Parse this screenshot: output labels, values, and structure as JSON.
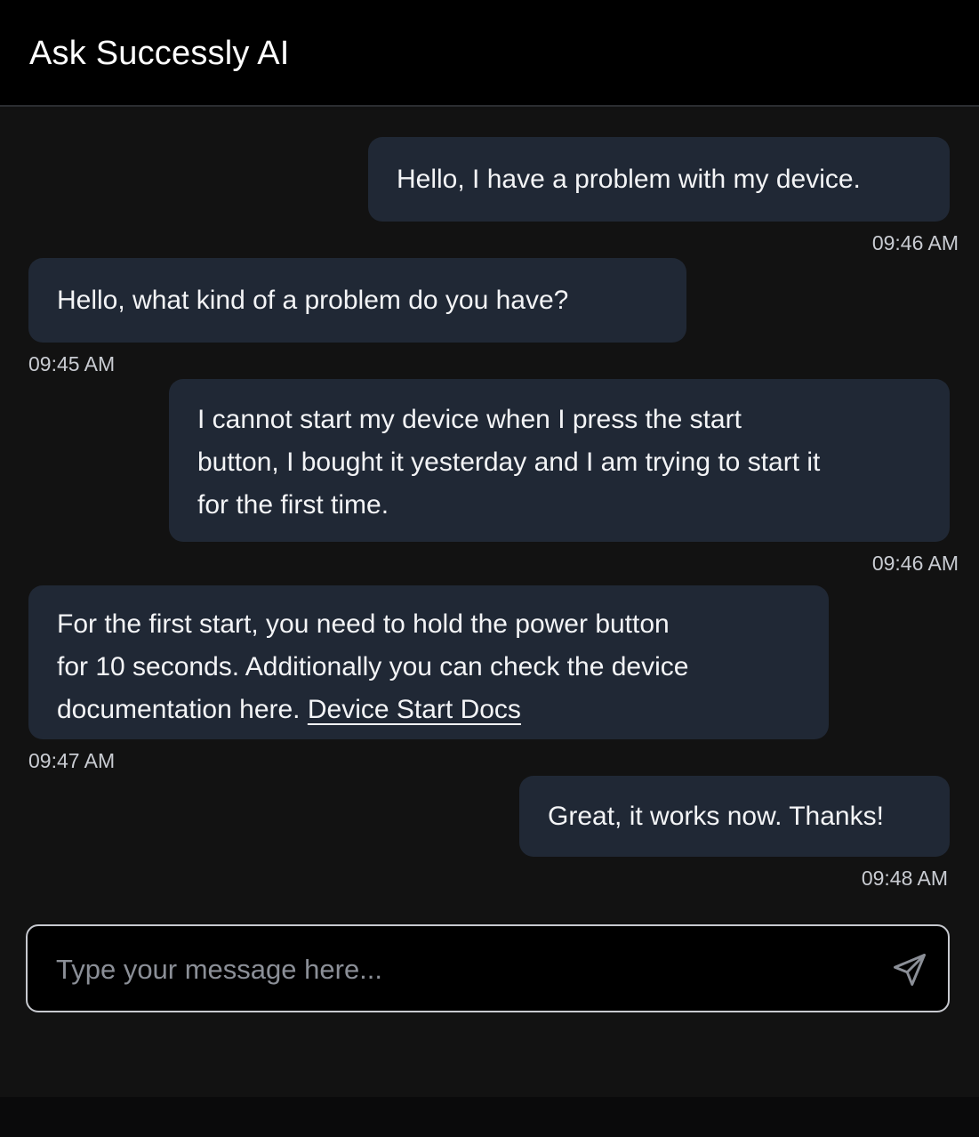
{
  "header": {
    "title": "Ask Successly AI"
  },
  "messages": [
    {
      "sender": "user",
      "text": "Hello, I have a problem with my device.",
      "time": "09:46 AM"
    },
    {
      "sender": "bot",
      "text": "Hello, what kind of a problem do you have?",
      "time": "09:45 AM"
    },
    {
      "sender": "user",
      "lines": [
        "I cannot start my device when I press the start",
        "button, I bought it yesterday and I am trying to start it",
        "for the first time."
      ],
      "time": "09:46 AM"
    },
    {
      "sender": "bot",
      "lines": [
        "For the first start, you need to hold the power button",
        "for 10 seconds. Additionally you can check the device",
        "documentation here. "
      ],
      "link_text": "Device Start Docs",
      "time": "09:47 AM"
    },
    {
      "sender": "user",
      "text": "Great, it works now. Thanks!",
      "time": "09:48 AM"
    }
  ],
  "composer": {
    "placeholder": "Type your message here...",
    "send_icon": "paper-plane-icon"
  },
  "colors": {
    "header_bg": "#000000",
    "chat_bg": "#121212",
    "bubble_bg": "#202835",
    "text": "#f3f4f6",
    "timestamp": "#c9ccd2",
    "input_border": "#c7c9cf"
  }
}
